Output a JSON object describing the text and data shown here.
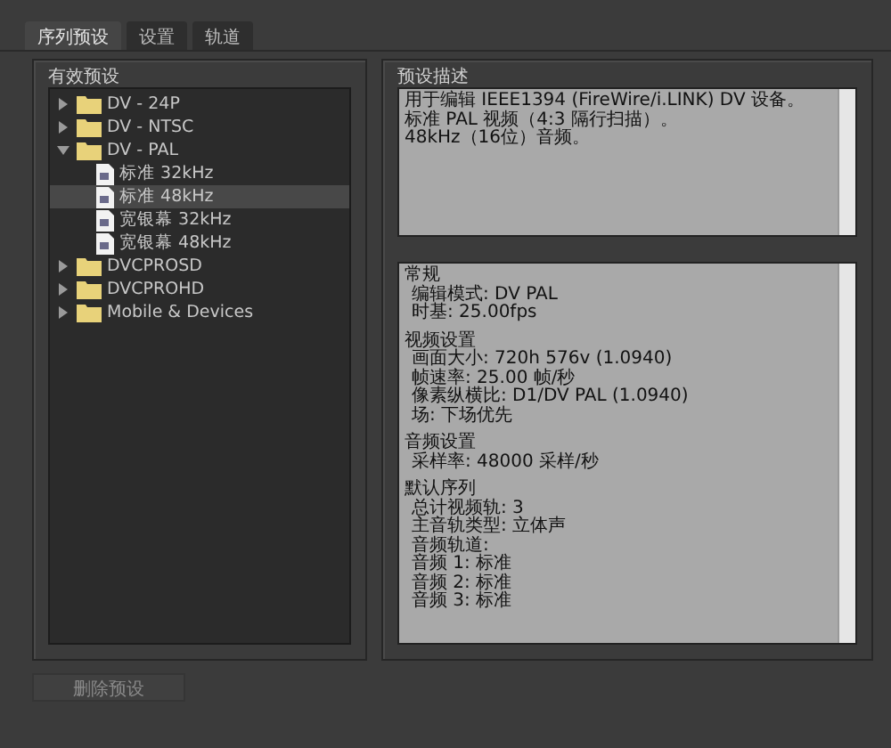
{
  "tabs": [
    {
      "label": "序列预设",
      "selected": true
    },
    {
      "label": "设置",
      "selected": false
    },
    {
      "label": "轨道",
      "selected": false
    }
  ],
  "presets": {
    "title": "有效预设",
    "tree": [
      {
        "kind": "folder",
        "label": "DV - 24P",
        "expanded": false,
        "selected": false
      },
      {
        "kind": "folder",
        "label": "DV - NTSC",
        "expanded": false,
        "selected": false
      },
      {
        "kind": "folder",
        "label": "DV - PAL",
        "expanded": true,
        "selected": false,
        "children": [
          {
            "kind": "preset",
            "label": "标准 32kHz",
            "selected": false
          },
          {
            "kind": "preset",
            "label": "标准 48kHz",
            "selected": true
          },
          {
            "kind": "preset",
            "label": "宽银幕 32kHz",
            "selected": false
          },
          {
            "kind": "preset",
            "label": "宽银幕 48kHz",
            "selected": false
          }
        ]
      },
      {
        "kind": "folder",
        "label": "DVCPROSD",
        "expanded": false,
        "selected": false
      },
      {
        "kind": "folder",
        "label": "DVCPROHD",
        "expanded": false,
        "selected": false
      },
      {
        "kind": "folder",
        "label": "Mobile & Devices",
        "expanded": false,
        "selected": false
      }
    ]
  },
  "description": {
    "title": "预设描述",
    "lines": [
      "用于编辑 IEEE1394 (FireWire/i.LINK) DV 设备。",
      "标准 PAL 视频（4:3 隔行扫描）。",
      "48kHz（16位）音频。"
    ]
  },
  "details": [
    {
      "heading": "常规",
      "lines": [
        "编辑模式: DV PAL",
        "时基: 25.00fps"
      ]
    },
    {
      "heading": "视频设置",
      "lines": [
        "画面大小: 720h 576v (1.0940)",
        "帧速率: 25.00 帧/秒",
        "像素纵横比: D1/DV PAL (1.0940)",
        "场: 下场优先"
      ]
    },
    {
      "heading": "音频设置",
      "lines": [
        "采样率: 48000 采样/秒"
      ]
    },
    {
      "heading": "默认序列",
      "lines": [
        "总计视频轨: 3",
        "主音轨类型: 立体声",
        "音频轨道:",
        "音频 1: 标准",
        "音频 2: 标准",
        "音频 3: 标准"
      ]
    }
  ],
  "delete_button": {
    "label": "删除预设",
    "disabled": true
  }
}
